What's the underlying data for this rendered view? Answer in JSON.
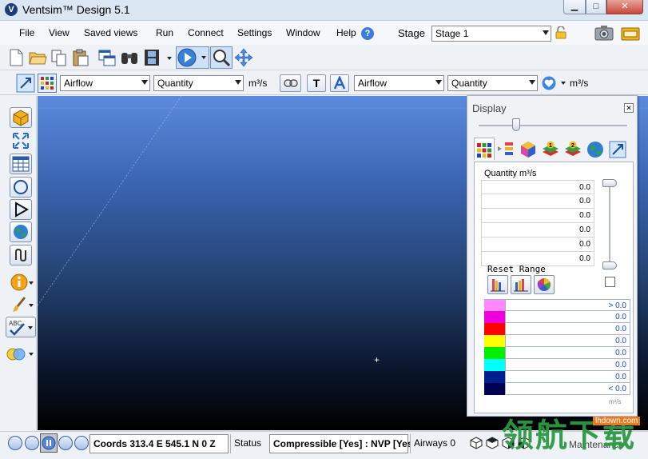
{
  "window": {
    "title": "Ventsim™ Design 5.1",
    "app_icon_letter": "V",
    "min": "▁",
    "max": "□",
    "close": "✕"
  },
  "menu": [
    "File",
    "View",
    "Saved views",
    "Run",
    "Connect",
    "Settings",
    "Window",
    "Help"
  ],
  "help_glyph": "?",
  "stage": {
    "label": "Stage",
    "value": "Stage 1"
  },
  "toolbar2": {
    "left_type": "Airflow",
    "left_quantity": "Quantity",
    "left_unit": "m³/s",
    "text_button": "T",
    "right_type": "Airflow",
    "right_quantity": "Quantity",
    "right_unit": "m³/s"
  },
  "display_panel": {
    "title": "Display",
    "close": "✕",
    "quantity_label": "Quantity m³/s",
    "values": [
      "0.0",
      "0.0",
      "0.0",
      "0.0",
      "0.0",
      "0.0"
    ],
    "reset_label": "Reset Range",
    "color_legend": [
      {
        "color": "#ff88ff",
        "label": "> 0.0"
      },
      {
        "color": "#ee00dd",
        "label": "0.0"
      },
      {
        "color": "#ff0000",
        "label": "0.0"
      },
      {
        "color": "#ffff00",
        "label": "0.0"
      },
      {
        "color": "#00ee00",
        "label": "0.0"
      },
      {
        "color": "#00ffff",
        "label": "0.0"
      },
      {
        "color": "#001e8c",
        "label": "0.0"
      },
      {
        "color": "#000050",
        "label": "< 0.0"
      }
    ],
    "unit": "m³/s"
  },
  "status": {
    "coords": "Coords 313.4 E    545.1 N    0 Z",
    "status_label": "Status",
    "compress": "Compressible [Yes] : NVP [Yes]",
    "airways": "Airways 0",
    "maintenance": "Maintenance"
  },
  "watermark": {
    "text": "领航下载",
    "url": "lhdown.com"
  }
}
